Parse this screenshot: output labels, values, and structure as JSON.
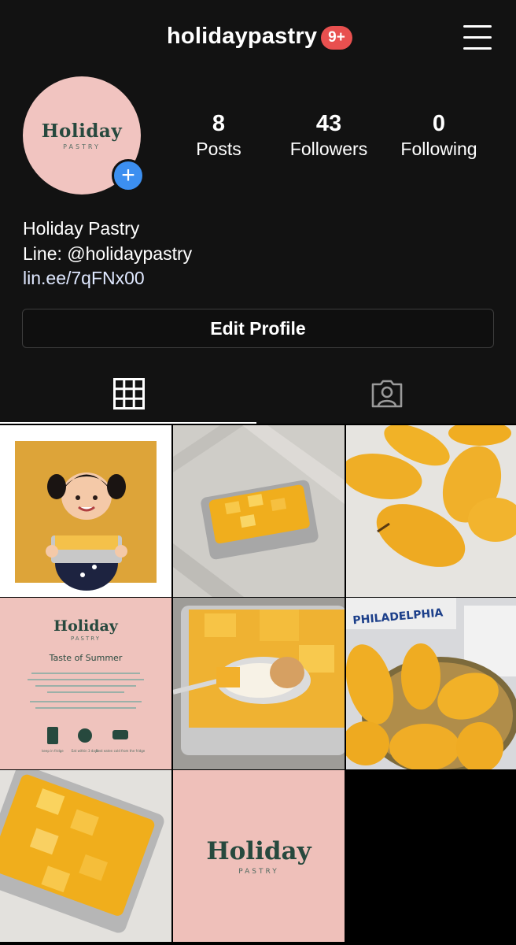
{
  "header": {
    "username": "holidaypastry",
    "notifications_badge": "9+",
    "menu_icon": "hamburger-menu-icon"
  },
  "profile": {
    "avatar": {
      "logo_word": "Holiday",
      "logo_sub": "PASTRY"
    },
    "stats": [
      {
        "value": "8",
        "label": "Posts"
      },
      {
        "value": "43",
        "label": "Followers"
      },
      {
        "value": "0",
        "label": "Following"
      }
    ],
    "bio": {
      "name": "Holiday Pastry",
      "line": "Line: @holidaypastry",
      "link": "lin.ee/7qFNx00"
    },
    "edit_button_label": "Edit Profile"
  },
  "tabs": [
    {
      "icon": "grid-icon",
      "active": true
    },
    {
      "icon": "tagged-person-icon",
      "active": false
    }
  ],
  "posts": {
    "post4": {
      "title": "Holiday",
      "subtitle": "PASTRY",
      "heading": "Taste of Summer",
      "caption_1": "keep in fridge",
      "caption_2": "Eat within 3 days",
      "caption_3": "Best eaten cold from the fridge"
    },
    "post5_brand": "PHILADELPHIA",
    "post8": {
      "title": "Holiday",
      "subtitle": "PASTRY"
    }
  },
  "colors": {
    "background": "#121212",
    "badge": "#e8504f",
    "add_story": "#3c8ff0",
    "brand_pink": "#f1c4c0",
    "brand_green": "#27493e"
  }
}
